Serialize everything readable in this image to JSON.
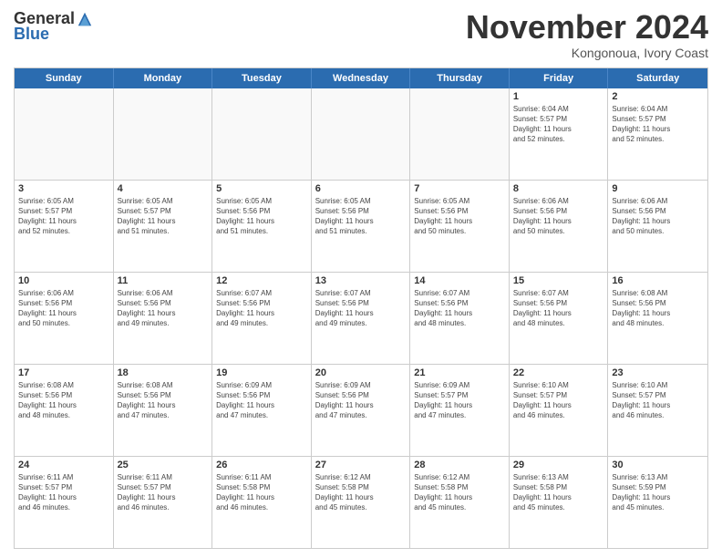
{
  "logo": {
    "general": "General",
    "blue": "Blue"
  },
  "title": "November 2024",
  "location": "Kongonoua, Ivory Coast",
  "header": {
    "days": [
      "Sunday",
      "Monday",
      "Tuesday",
      "Wednesday",
      "Thursday",
      "Friday",
      "Saturday"
    ]
  },
  "weeks": [
    [
      {
        "day": "",
        "info": ""
      },
      {
        "day": "",
        "info": ""
      },
      {
        "day": "",
        "info": ""
      },
      {
        "day": "",
        "info": ""
      },
      {
        "day": "",
        "info": ""
      },
      {
        "day": "1",
        "info": "Sunrise: 6:04 AM\nSunset: 5:57 PM\nDaylight: 11 hours\nand 52 minutes."
      },
      {
        "day": "2",
        "info": "Sunrise: 6:04 AM\nSunset: 5:57 PM\nDaylight: 11 hours\nand 52 minutes."
      }
    ],
    [
      {
        "day": "3",
        "info": "Sunrise: 6:05 AM\nSunset: 5:57 PM\nDaylight: 11 hours\nand 52 minutes."
      },
      {
        "day": "4",
        "info": "Sunrise: 6:05 AM\nSunset: 5:57 PM\nDaylight: 11 hours\nand 51 minutes."
      },
      {
        "day": "5",
        "info": "Sunrise: 6:05 AM\nSunset: 5:56 PM\nDaylight: 11 hours\nand 51 minutes."
      },
      {
        "day": "6",
        "info": "Sunrise: 6:05 AM\nSunset: 5:56 PM\nDaylight: 11 hours\nand 51 minutes."
      },
      {
        "day": "7",
        "info": "Sunrise: 6:05 AM\nSunset: 5:56 PM\nDaylight: 11 hours\nand 50 minutes."
      },
      {
        "day": "8",
        "info": "Sunrise: 6:06 AM\nSunset: 5:56 PM\nDaylight: 11 hours\nand 50 minutes."
      },
      {
        "day": "9",
        "info": "Sunrise: 6:06 AM\nSunset: 5:56 PM\nDaylight: 11 hours\nand 50 minutes."
      }
    ],
    [
      {
        "day": "10",
        "info": "Sunrise: 6:06 AM\nSunset: 5:56 PM\nDaylight: 11 hours\nand 50 minutes."
      },
      {
        "day": "11",
        "info": "Sunrise: 6:06 AM\nSunset: 5:56 PM\nDaylight: 11 hours\nand 49 minutes."
      },
      {
        "day": "12",
        "info": "Sunrise: 6:07 AM\nSunset: 5:56 PM\nDaylight: 11 hours\nand 49 minutes."
      },
      {
        "day": "13",
        "info": "Sunrise: 6:07 AM\nSunset: 5:56 PM\nDaylight: 11 hours\nand 49 minutes."
      },
      {
        "day": "14",
        "info": "Sunrise: 6:07 AM\nSunset: 5:56 PM\nDaylight: 11 hours\nand 48 minutes."
      },
      {
        "day": "15",
        "info": "Sunrise: 6:07 AM\nSunset: 5:56 PM\nDaylight: 11 hours\nand 48 minutes."
      },
      {
        "day": "16",
        "info": "Sunrise: 6:08 AM\nSunset: 5:56 PM\nDaylight: 11 hours\nand 48 minutes."
      }
    ],
    [
      {
        "day": "17",
        "info": "Sunrise: 6:08 AM\nSunset: 5:56 PM\nDaylight: 11 hours\nand 48 minutes."
      },
      {
        "day": "18",
        "info": "Sunrise: 6:08 AM\nSunset: 5:56 PM\nDaylight: 11 hours\nand 47 minutes."
      },
      {
        "day": "19",
        "info": "Sunrise: 6:09 AM\nSunset: 5:56 PM\nDaylight: 11 hours\nand 47 minutes."
      },
      {
        "day": "20",
        "info": "Sunrise: 6:09 AM\nSunset: 5:56 PM\nDaylight: 11 hours\nand 47 minutes."
      },
      {
        "day": "21",
        "info": "Sunrise: 6:09 AM\nSunset: 5:57 PM\nDaylight: 11 hours\nand 47 minutes."
      },
      {
        "day": "22",
        "info": "Sunrise: 6:10 AM\nSunset: 5:57 PM\nDaylight: 11 hours\nand 46 minutes."
      },
      {
        "day": "23",
        "info": "Sunrise: 6:10 AM\nSunset: 5:57 PM\nDaylight: 11 hours\nand 46 minutes."
      }
    ],
    [
      {
        "day": "24",
        "info": "Sunrise: 6:11 AM\nSunset: 5:57 PM\nDaylight: 11 hours\nand 46 minutes."
      },
      {
        "day": "25",
        "info": "Sunrise: 6:11 AM\nSunset: 5:57 PM\nDaylight: 11 hours\nand 46 minutes."
      },
      {
        "day": "26",
        "info": "Sunrise: 6:11 AM\nSunset: 5:58 PM\nDaylight: 11 hours\nand 46 minutes."
      },
      {
        "day": "27",
        "info": "Sunrise: 6:12 AM\nSunset: 5:58 PM\nDaylight: 11 hours\nand 45 minutes."
      },
      {
        "day": "28",
        "info": "Sunrise: 6:12 AM\nSunset: 5:58 PM\nDaylight: 11 hours\nand 45 minutes."
      },
      {
        "day": "29",
        "info": "Sunrise: 6:13 AM\nSunset: 5:58 PM\nDaylight: 11 hours\nand 45 minutes."
      },
      {
        "day": "30",
        "info": "Sunrise: 6:13 AM\nSunset: 5:59 PM\nDaylight: 11 hours\nand 45 minutes."
      }
    ]
  ]
}
